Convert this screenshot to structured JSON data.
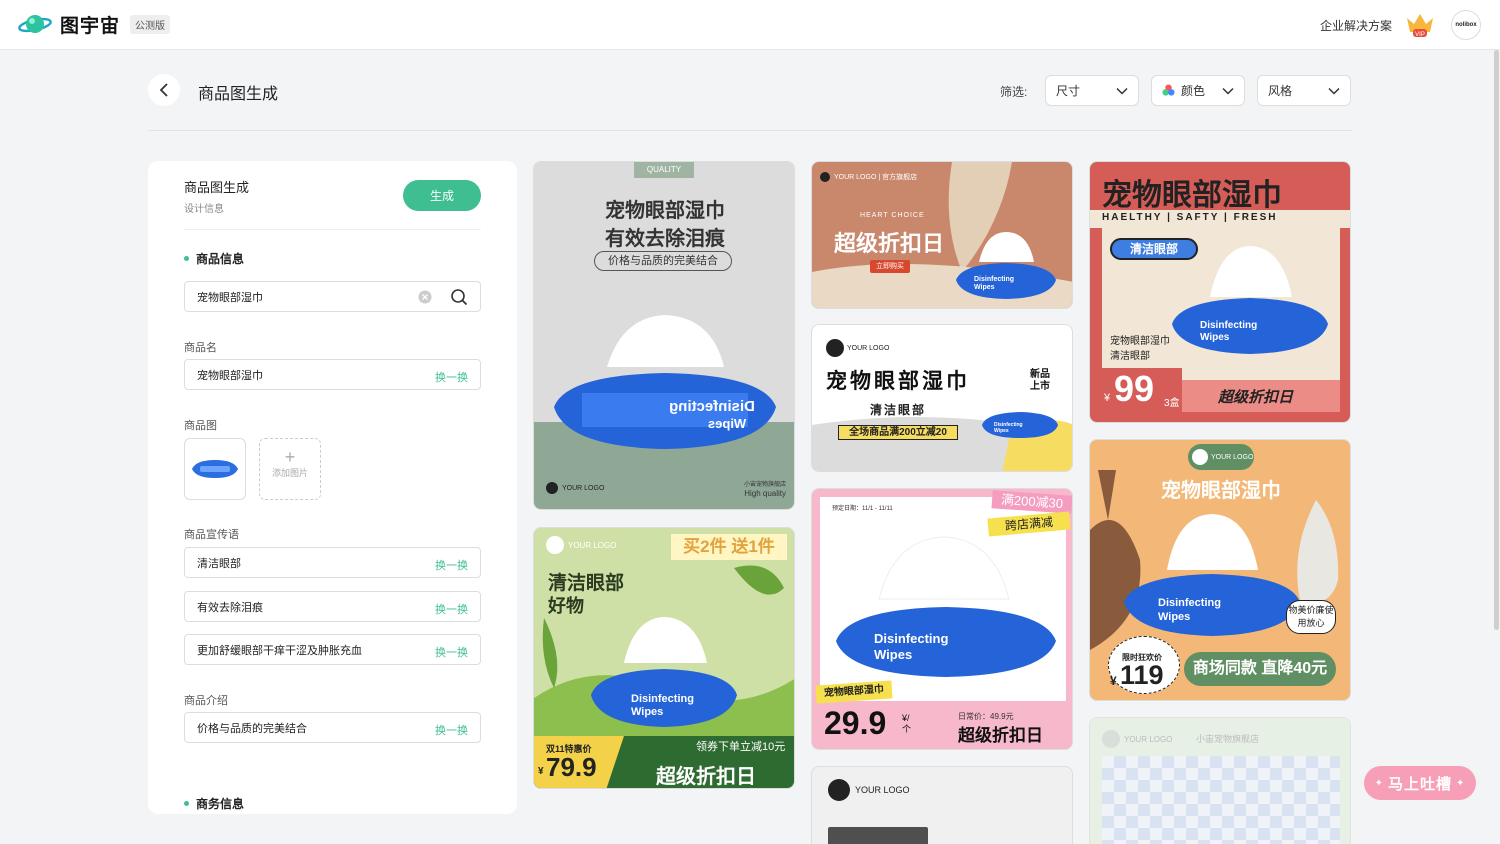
{
  "header": {
    "brand": "图宇宙",
    "beta": "公测版",
    "enterprise": "企业解决方案",
    "vip": "VIP",
    "avatar": "nolibox"
  },
  "page": {
    "title": "商品图生成",
    "filter_label": "筛选:",
    "filters": [
      "尺寸",
      "颜色",
      "风格"
    ]
  },
  "panel": {
    "title": "商品图生成",
    "subtitle": "设计信息",
    "generate": "生成",
    "section_product": "商品信息",
    "search_value": "宠物眼部湿巾",
    "name_label": "商品名",
    "name_value": "宠物眼部湿巾",
    "swap": "换一换",
    "image_label": "商品图",
    "add_image": "添加图片",
    "slogan_label": "商品宣传语",
    "slogans": [
      "清洁眼部",
      "有效去除泪痕",
      "更加舒缓眼部干痒干涩及肿胀充血"
    ],
    "intro_label": "商品介绍",
    "intro_value": "价格与品质的完美结合",
    "section_business": "商务信息"
  },
  "pack": {
    "line1": "Disinfecting",
    "line2": "Wipes"
  },
  "cards": {
    "c1": {
      "tag": "QUALITY",
      "title1": "宠物眼部湿巾",
      "title2": "有效去除泪痕",
      "tagline": "价格与品质的完美结合",
      "logo": "YOUR LOGO",
      "store": "小宙宠物旗舰店",
      "quality": "High quality"
    },
    "c2": {
      "logo": "YOUR LOGO",
      "promo": "买2件 送1件",
      "title1": "清洁眼部",
      "title2": "好物",
      "sale": "双11特惠价",
      "currency": "¥",
      "price": "79.9",
      "coupon": "领券下单立减10元",
      "slogan": "超级折扣日"
    },
    "c3": {
      "header": "YOUR LOGO | 官方旗舰店",
      "eyebrow": "HEART CHOICE",
      "title": "超级折扣日",
      "cta": "立即购买"
    },
    "c4": {
      "logo": "YOUR LOGO",
      "title": "宠物眼部湿巾",
      "sub": "清洁眼部",
      "new": "新品上市",
      "promo": "全场商品满200立减20"
    },
    "c5": {
      "date": "预定日期：11/1 - 11/11",
      "promo1": "满200减30",
      "promo2": "跨店满减",
      "label": "宠物眼部湿巾",
      "price": "29.9",
      "unit": "¥/个",
      "regular": "日常价：49.9元",
      "slogan": "超级折扣日"
    },
    "c6": {
      "logo": "YOUR LOGO"
    },
    "c7": {
      "title": "宠物眼部湿巾",
      "tagline": "HAELTHY | SAFTY | FRESH",
      "badge": "清洁眼部",
      "desc1": "宠物眼部湿巾",
      "desc2": "清洁眼部",
      "currency": "¥",
      "price": "99",
      "unit": "3盒",
      "slogan": "超级折扣日"
    },
    "c8": {
      "logo": "YOUR LOGO",
      "title": "宠物眼部湿巾",
      "bubble": "物美价廉使用放心",
      "sale": "限时狂欢价",
      "currency": "¥",
      "price": "119",
      "slogan": "商场同款 直降40元"
    },
    "c9": {
      "logo": "YOUR LOGO",
      "store": "小宙宠物旗舰店"
    }
  },
  "feedback": "马上吐槽",
  "colors": {
    "accent": "#3fbf91",
    "feedback": "#f79fb6"
  }
}
